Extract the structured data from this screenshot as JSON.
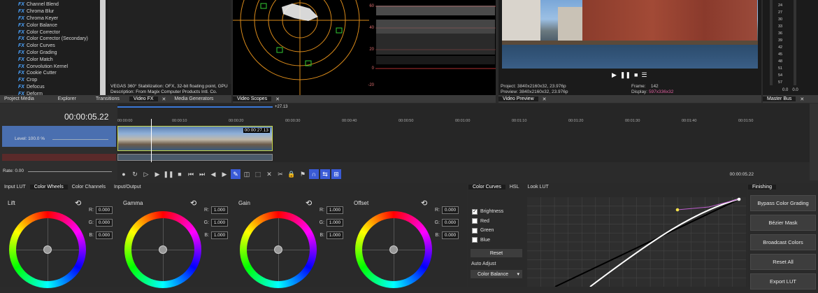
{
  "fx_list": [
    "Channel Blend",
    "Chroma Blur",
    "Chroma Keyer",
    "Color Balance",
    "Color Corrector",
    "Color Corrector (Secondary)",
    "Color Curves",
    "Color Grading",
    "Color Match",
    "Convolution Kernel",
    "Cookie Cutter",
    "Crop",
    "Defocus",
    "Deform"
  ],
  "fx_badge": "FX",
  "plugin_desc_line1": "VEGAS 360° Stabilization: OFX, 32-bit floating point, GPU",
  "plugin_desc_line2": "Description: From Magix Computer Products Intl. Co.",
  "top_tabs": [
    "Project Media",
    "Explorer",
    "Transitions",
    "Video FX",
    "Media Generators"
  ],
  "scopes_tab": "Video Scopes",
  "preview_tab": "Video Preview",
  "master_tab": "Master Bus",
  "scope_labels": [
    "60",
    "40",
    "20",
    "0",
    "-20"
  ],
  "preview_info": {
    "project_label": "Project:",
    "project_val": "3840x2160x32, 23.976p",
    "preview_label": "Preview:",
    "preview_val": "3840x2160x32, 23.976p",
    "frame_label": "Frame:",
    "frame_val": "142",
    "display_label": "Display:",
    "display_val": "597x336x32"
  },
  "meter_labels": [
    "24",
    "27",
    "30",
    "33",
    "36",
    "39",
    "42",
    "45",
    "48",
    "51",
    "54",
    "57"
  ],
  "meter_bottom": [
    "0.0",
    "0.0"
  ],
  "timecode": "00:00:05.22",
  "track_level": "Level: 100.0 %",
  "rate": "Rate: 0.00",
  "ruler_marks": [
    "00:00:00",
    "00:00:10",
    "00:00:20",
    "00:00:30",
    "00:00:40",
    "00:00:50",
    "00:01:00",
    "00:01:10",
    "00:01:20",
    "00:01:30",
    "00:01:40",
    "00:01:50"
  ],
  "clip_time": "00:00:27.13",
  "loop_end": "+27.13",
  "transport_time": "00:00:05.22",
  "grading_tabs": [
    "Input LUT",
    "Color Wheels",
    "Color Channels",
    "Input/Output"
  ],
  "wheels": [
    {
      "name": "Lift",
      "r": "0.000",
      "g": "0.000",
      "b": "0.000"
    },
    {
      "name": "Gamma",
      "r": "1.000",
      "g": "1.000",
      "b": "1.000"
    },
    {
      "name": "Gain",
      "r": "1.000",
      "g": "1.000",
      "b": "1.000"
    },
    {
      "name": "Offset",
      "r": "0.000",
      "g": "0.000",
      "b": "0.000"
    }
  ],
  "rgb_labels": [
    "R:",
    "G:",
    "B:"
  ],
  "curve_tabs": [
    "Color Curves",
    "HSL",
    "Look LUT"
  ],
  "channels": [
    {
      "label": "Brightness",
      "checked": true
    },
    {
      "label": "Red",
      "checked": false
    },
    {
      "label": "Green",
      "checked": false
    },
    {
      "label": "Blue",
      "checked": false
    }
  ],
  "check_mark": "✓",
  "reset_label": "Reset",
  "auto_adjust_label": "Auto Adjust",
  "auto_adjust_value": "Color Balance",
  "finishing_tab": "Finishing",
  "finishing_buttons": [
    "Bypass Color Grading",
    "Bézier Mask",
    "Broadcast Colors",
    "Reset All",
    "Export LUT"
  ],
  "colors": {
    "accent": "#3a5bd6",
    "clip_border": "#c8d84a",
    "track_blue": "#4a6fb0",
    "curve_pink": "#c05fd0"
  }
}
